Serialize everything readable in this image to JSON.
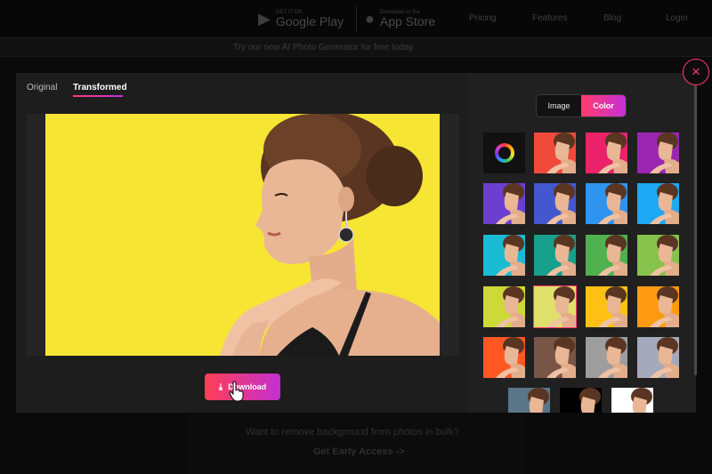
{
  "background": {
    "store_google_small": "GET IT ON",
    "store_google": "Google Play",
    "store_apple_small": "Download on the",
    "store_apple": "App Store",
    "nav": [
      "Pricing",
      "Features",
      "Blog",
      "Login"
    ],
    "banner": "Try our new AI Photo Generator for free today",
    "bottom_line1": "Want to remove background from photos in bulk?",
    "bottom_line2": "Get Early Access ->"
  },
  "modal": {
    "tabs": [
      {
        "label": "Original",
        "active": false
      },
      {
        "label": "Transformed",
        "active": true
      }
    ],
    "download_label": "Download",
    "canvas_color": "#f7e534",
    "close_symbol": "×",
    "toggle": [
      {
        "label": "Image",
        "active": false
      },
      {
        "label": "Color",
        "active": true
      }
    ],
    "swatches": [
      "color-wheel",
      "#f04a3a",
      "#e9226a",
      "#9b27b0",
      "#6a3fd1",
      "#4358cf",
      "#2f93f0",
      "#1ea8f4",
      "#19bcd3",
      "#17a08b",
      "#4fb24f",
      "#86c24c",
      "#cdd936",
      "#e0df6c",
      "#ffc014",
      "#ff9a12",
      "#ff5722",
      "#795548",
      "#9e9e9e",
      "#a6a9bb",
      "#5a7688",
      "#000000",
      "#ffffff"
    ],
    "selected_swatch": 13
  },
  "accent": "#ff3b6b"
}
